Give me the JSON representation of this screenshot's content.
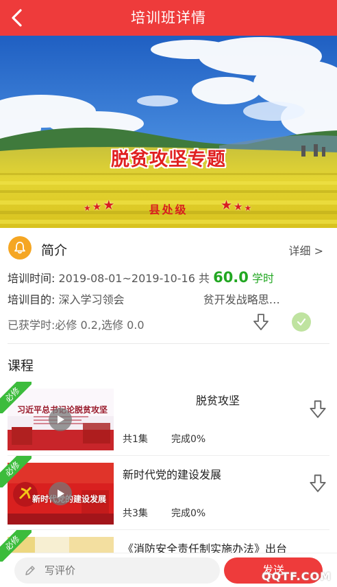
{
  "header": {
    "title": "培训班详情"
  },
  "banner": {
    "title": "脱贫攻坚专题",
    "level": "县处级"
  },
  "intro": {
    "title": "简介",
    "more_label": "详细 >"
  },
  "info": {
    "time_label": "培训时间:",
    "time_value": "2019-08-01~2019-10-16",
    "total_prefix": "共",
    "hours_value": "60.0",
    "hours_unit": "学时",
    "goal_label": "培训目的:",
    "goal_value": "深入学习领会",
    "goal_value_2": "贫开发战略思…",
    "earned_text": "已获学时:必修 0.2,选修 0.0"
  },
  "courses": {
    "section_title": "课程",
    "tag_label": "必修",
    "items": [
      {
        "name": "脱贫攻坚",
        "thumb_text": "习近平总书记论脱贫攻坚",
        "count": "共1集",
        "progress": "完成0%"
      },
      {
        "name": "新时代党的建设发展",
        "thumb_text": "新时代党的建设发展",
        "count": "共3集",
        "progress": "完成0%"
      },
      {
        "name": "《消防安全责任制实施办法》出台",
        "thumb_text": "",
        "count": "",
        "progress": ""
      }
    ]
  },
  "footer": {
    "comment_placeholder": "写评价",
    "send_label": "发送"
  },
  "watermark": "QQTF.COM"
}
